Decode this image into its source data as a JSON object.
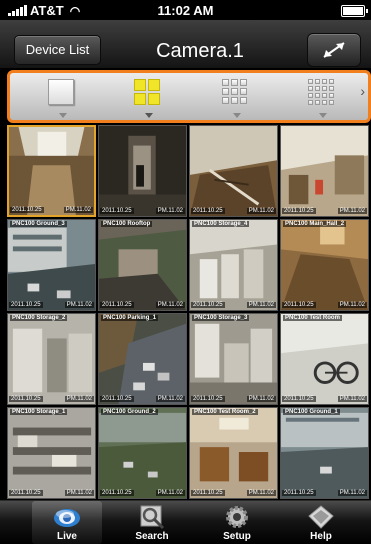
{
  "status_bar": {
    "carrier": "AT&T",
    "time": "11:02 AM"
  },
  "nav": {
    "back_label": "Device List",
    "title": "Camera.1"
  },
  "layout_options": [
    {
      "name": "single-view",
      "active": false
    },
    {
      "name": "quad-view",
      "active": true
    },
    {
      "name": "nine-view",
      "active": false
    },
    {
      "name": "sixteen-view",
      "active": false
    }
  ],
  "cameras": [
    {
      "name": "",
      "date": "2011.10.25",
      "time": "PM.11.02",
      "selected": true
    },
    {
      "name": "",
      "date": "2011.10.25",
      "time": "PM.11.02",
      "selected": false
    },
    {
      "name": "",
      "date": "2011.10.25",
      "time": "PM.11.02",
      "selected": false
    },
    {
      "name": "",
      "date": "2011.10.25",
      "time": "PM.11.02",
      "selected": false
    },
    {
      "name": "PNC100 Ground_3",
      "date": "2011.10.25",
      "time": "PM.11.02",
      "selected": false
    },
    {
      "name": "PNC100 Rooftop",
      "date": "2011.10.25",
      "time": "PM.11.02",
      "selected": false
    },
    {
      "name": "PNC100 Storage_4",
      "date": "2011.10.25",
      "time": "PM.11.02",
      "selected": false
    },
    {
      "name": "PNC100 Main_Hall_2",
      "date": "2011.10.25",
      "time": "PM.11.02",
      "selected": false
    },
    {
      "name": "PNC100 Storage_2",
      "date": "2011.10.25",
      "time": "PM.11.02",
      "selected": false
    },
    {
      "name": "PNC100 Parking_1",
      "date": "2011.10.25",
      "time": "PM.11.02",
      "selected": false
    },
    {
      "name": "PNC100 Storage_3",
      "date": "2011.10.25",
      "time": "PM.11.02",
      "selected": false
    },
    {
      "name": "PNC100 Test Room",
      "date": "2011.10.25",
      "time": "PM.11.02",
      "selected": false
    },
    {
      "name": "PNC100 Storage_1",
      "date": "2011.10.25",
      "time": "PM.11.02",
      "selected": false
    },
    {
      "name": "PNC100 Ground_2",
      "date": "2011.10.25",
      "time": "PM.11.02",
      "selected": false
    },
    {
      "name": "PNC100 Test Room_2",
      "date": "2011.10.25",
      "time": "PM.11.02",
      "selected": false
    },
    {
      "name": "PNC100 Ground_1",
      "date": "2011.10.25",
      "time": "PM.11.02",
      "selected": false
    }
  ],
  "tabs": [
    {
      "label": "Live",
      "icon": "live-camera-icon",
      "active": true
    },
    {
      "label": "Search",
      "icon": "search-magnifier-icon",
      "active": false
    },
    {
      "label": "Setup",
      "icon": "gear-icon",
      "active": false
    },
    {
      "label": "Help",
      "icon": "help-icon",
      "active": false
    }
  ],
  "colors": {
    "highlight_border": "#f27f1e",
    "active_layout": "#f1e52a",
    "selected_tile": "#e2a42a"
  }
}
